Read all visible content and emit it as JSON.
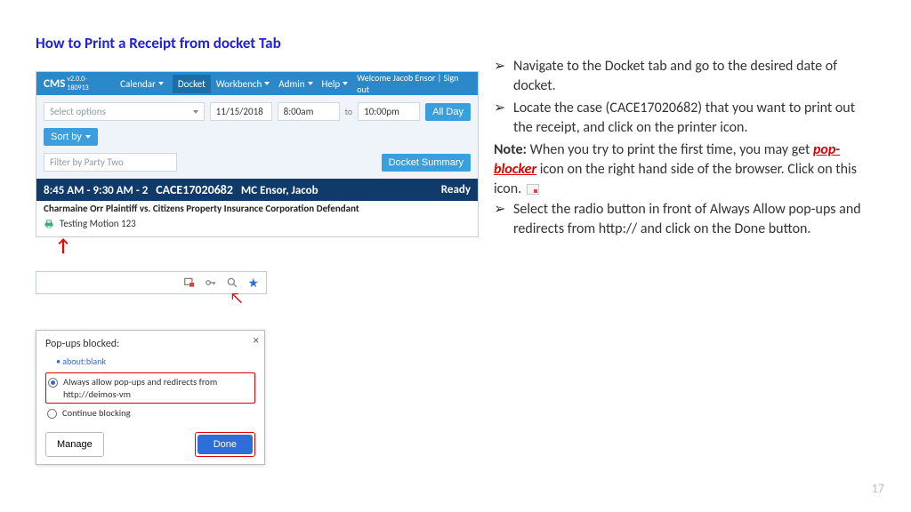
{
  "title": "How to Print a Receipt from docket Tab",
  "page_number": "17",
  "cms": {
    "logo": "CMS",
    "version": "v2.0.0-180913",
    "nav": {
      "calendar": "Calendar",
      "docket": "Docket",
      "workbench": "Workbench",
      "admin": "Admin",
      "help": "Help"
    },
    "welcome": "Welcome Jacob Ensor | Sign out",
    "select_placeholder": "Select options",
    "date": "11/15/2018",
    "time_from": "8:00am",
    "to": "to",
    "time_to": "10:00pm",
    "all_day": "All Day",
    "sort_by": "Sort by",
    "filter_placeholder": "Filter by Party Two",
    "docket_summary": "Docket Summary",
    "case": {
      "time": "8:45 AM - 9:30 AM - 2",
      "number": "CACE17020682",
      "judge": "MC  Ensor, Jacob",
      "status": "Ready",
      "parties": "Charmaine Orr Plaintiff vs. Citizens Property Insurance Corporation Defendant",
      "motion": "Testing Motion 123"
    }
  },
  "popup": {
    "title": "Pop-ups blocked:",
    "link": "about:blank",
    "opt_allow": "Always allow pop-ups and redirects from http://deimos-vm",
    "opt_block": "Continue blocking",
    "manage": "Manage",
    "done": "Done"
  },
  "instructions": {
    "b1": "Navigate to the Docket tab and go to the desired date of docket.",
    "b2": "Locate the case (CACE17020682) that you want to print out the receipt, and click on the printer icon.",
    "note_label": "Note:",
    "note1": " When you try to print the first time, you may get ",
    "pop_blocker": "pop-blocker",
    "note2": " icon on the right hand side of the browser. Click on this icon.  ",
    "b3": "Select the radio button in front of Always Allow pop-ups and redirects from http:// and click on the Done button."
  }
}
